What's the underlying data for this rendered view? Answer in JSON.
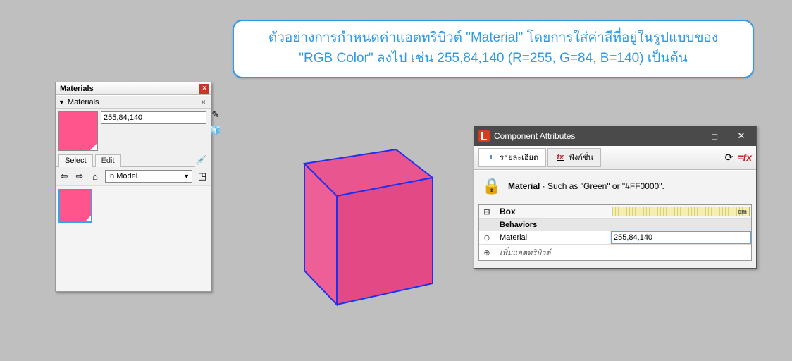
{
  "callout": {
    "line1": "ตัวอย่างการกำหนดค่าแอตทริบิวต์ \"Material\" โดยการใส่ค่าสีที่อยู่ในรูปแบบของ",
    "line2": "\"RGB Color\" ลงไป เช่น 255,84,140 (R=255, G=84, B=140) เป็นต้น"
  },
  "materials_panel": {
    "title": "Materials",
    "section": "Materials",
    "color_name": "255,84,140",
    "tab_select": "Select",
    "tab_edit": "Edit",
    "location": "In Model"
  },
  "cube_color": "rgb(255,84,140)",
  "component_attributes": {
    "title": "Component Attributes",
    "tab_details": "รายละเอียด",
    "tab_functions": "ฟังก์ชั่น",
    "desc_label": "Material",
    "desc_text": "Such as \"Green\" or \"#FF0000\".",
    "object_name": "Box",
    "ruler_unit": "cm",
    "group_behaviors": "Behaviors",
    "attr_material_name": "Material",
    "attr_material_value": "255,84,140",
    "add_attr": "เพิ่มแอตทริบิวต์"
  }
}
